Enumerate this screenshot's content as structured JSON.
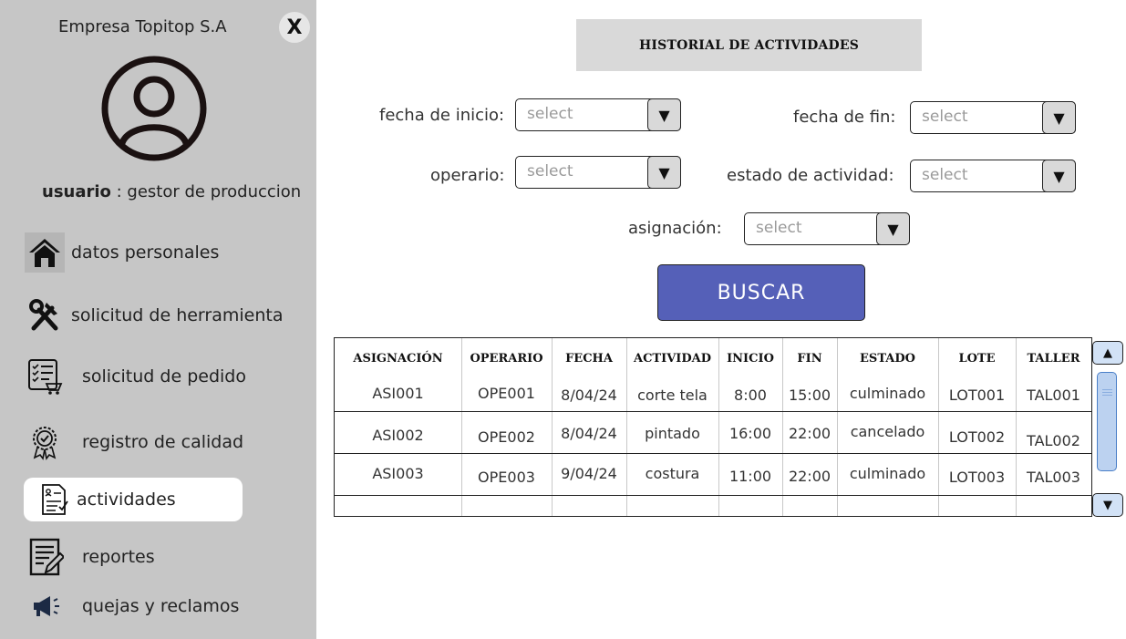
{
  "sidebar": {
    "company": "Empresa Topitop S.A",
    "close_label": "X",
    "user_label": "usuario",
    "user_role": " : gestor de produccion",
    "items": [
      {
        "label": "datos personales",
        "icon": "home-icon"
      },
      {
        "label": "solicitud de herramienta",
        "icon": "tools-icon"
      },
      {
        "label": "solicitud de pedido",
        "icon": "cart-checklist-icon"
      },
      {
        "label": "registro de calidad",
        "icon": "quality-badge-icon"
      },
      {
        "label": "actividades",
        "icon": "activities-doc-icon",
        "active": true
      },
      {
        "label": "reportes",
        "icon": "report-edit-icon"
      },
      {
        "label": "quejas y reclamos",
        "icon": "megaphone-icon"
      }
    ]
  },
  "main": {
    "title": "HISTORIAL DE ACTIVIDADES",
    "filters": {
      "fecha_inicio": {
        "label": "fecha de inicio:",
        "placeholder": "select"
      },
      "fecha_fin": {
        "label": "fecha de fin:",
        "placeholder": "select"
      },
      "operario": {
        "label": "operario:",
        "placeholder": "select"
      },
      "estado": {
        "label": "estado de actividad:",
        "placeholder": "select"
      },
      "asignacion": {
        "label": "asignación:",
        "placeholder": "select"
      }
    },
    "search_button": "BUSCAR",
    "table": {
      "columns": [
        "ASIGNACIÓN",
        "OPERARIO",
        "FECHA",
        "ACTIVIDAD",
        "INICIO",
        "FIN",
        "ESTADO",
        "LOTE",
        "TALLER"
      ],
      "rows": [
        [
          "ASI001",
          "OPE001",
          "8/04/24",
          "corte tela",
          "8:00",
          "15:00",
          "culminado",
          "LOT001",
          "TAL001"
        ],
        [
          "ASI002",
          "OPE002",
          "8/04/24",
          "pintado",
          "16:00",
          "22:00",
          "cancelado",
          "LOT002",
          "TAL002"
        ],
        [
          "ASI003",
          "OPE003",
          "9/04/24",
          "costura",
          "11:00",
          "22:00",
          "culminado",
          "LOT003",
          "TAL003"
        ]
      ]
    }
  },
  "colors": {
    "sidebar_bg": "#c6c6c6",
    "title_bg": "#d9d9d9",
    "button_bg": "#5560b8",
    "scroll_thumb": "#bcd2f0"
  }
}
